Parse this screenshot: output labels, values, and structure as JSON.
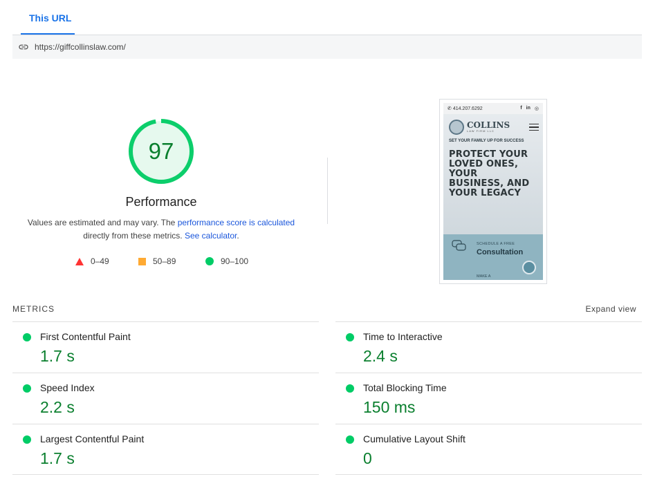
{
  "tabs": [
    {
      "label": "This URL"
    }
  ],
  "url_bar": {
    "url": "https://giffcollinslaw.com/",
    "icon": "link-icon"
  },
  "score": {
    "value": 97,
    "category": "Performance",
    "ring_fraction": 0.97,
    "color_pass": "#0cce6b",
    "color_pass_text": "#0a7f2e"
  },
  "description": {
    "prefix": "Values are estimated and may vary. The",
    "link1": "performance score is calculated",
    "middle": "directly from these metrics.",
    "link2": "See calculator",
    "suffix": "."
  },
  "legend": [
    {
      "range": "0–49",
      "shape": "triangle",
      "color": "#ff3333"
    },
    {
      "range": "50–89",
      "shape": "square",
      "color": "#ffaa33"
    },
    {
      "range": "90–100",
      "shape": "circle",
      "color": "#0cce6b"
    }
  ],
  "screenshot": {
    "phone": "414.207.6292",
    "social": [
      "f",
      "in",
      "◎"
    ],
    "brand_name": "COLLINS",
    "brand_sub": "LAW FIRM LLC",
    "tagline": "SET YOUR FAMILY UP FOR SUCCESS",
    "headline_lines": [
      "PROTECT YOUR",
      "LOVED ONES,",
      "YOUR",
      "BUSINESS, AND",
      "YOUR LEGACY"
    ],
    "cta_small": "SCHEDULE A FREE",
    "cta_big": "Consultation",
    "cta_more": "MAKE A"
  },
  "metrics": {
    "section_label": "METRICS",
    "expand_label": "Expand view",
    "items": [
      {
        "name": "First Contentful Paint",
        "value": "1.7 s"
      },
      {
        "name": "Time to Interactive",
        "value": "2.4 s"
      },
      {
        "name": "Speed Index",
        "value": "2.2 s"
      },
      {
        "name": "Total Blocking Time",
        "value": "150 ms"
      },
      {
        "name": "Largest Contentful Paint",
        "value": "1.7 s"
      },
      {
        "name": "Cumulative Layout Shift",
        "value": "0"
      }
    ]
  }
}
